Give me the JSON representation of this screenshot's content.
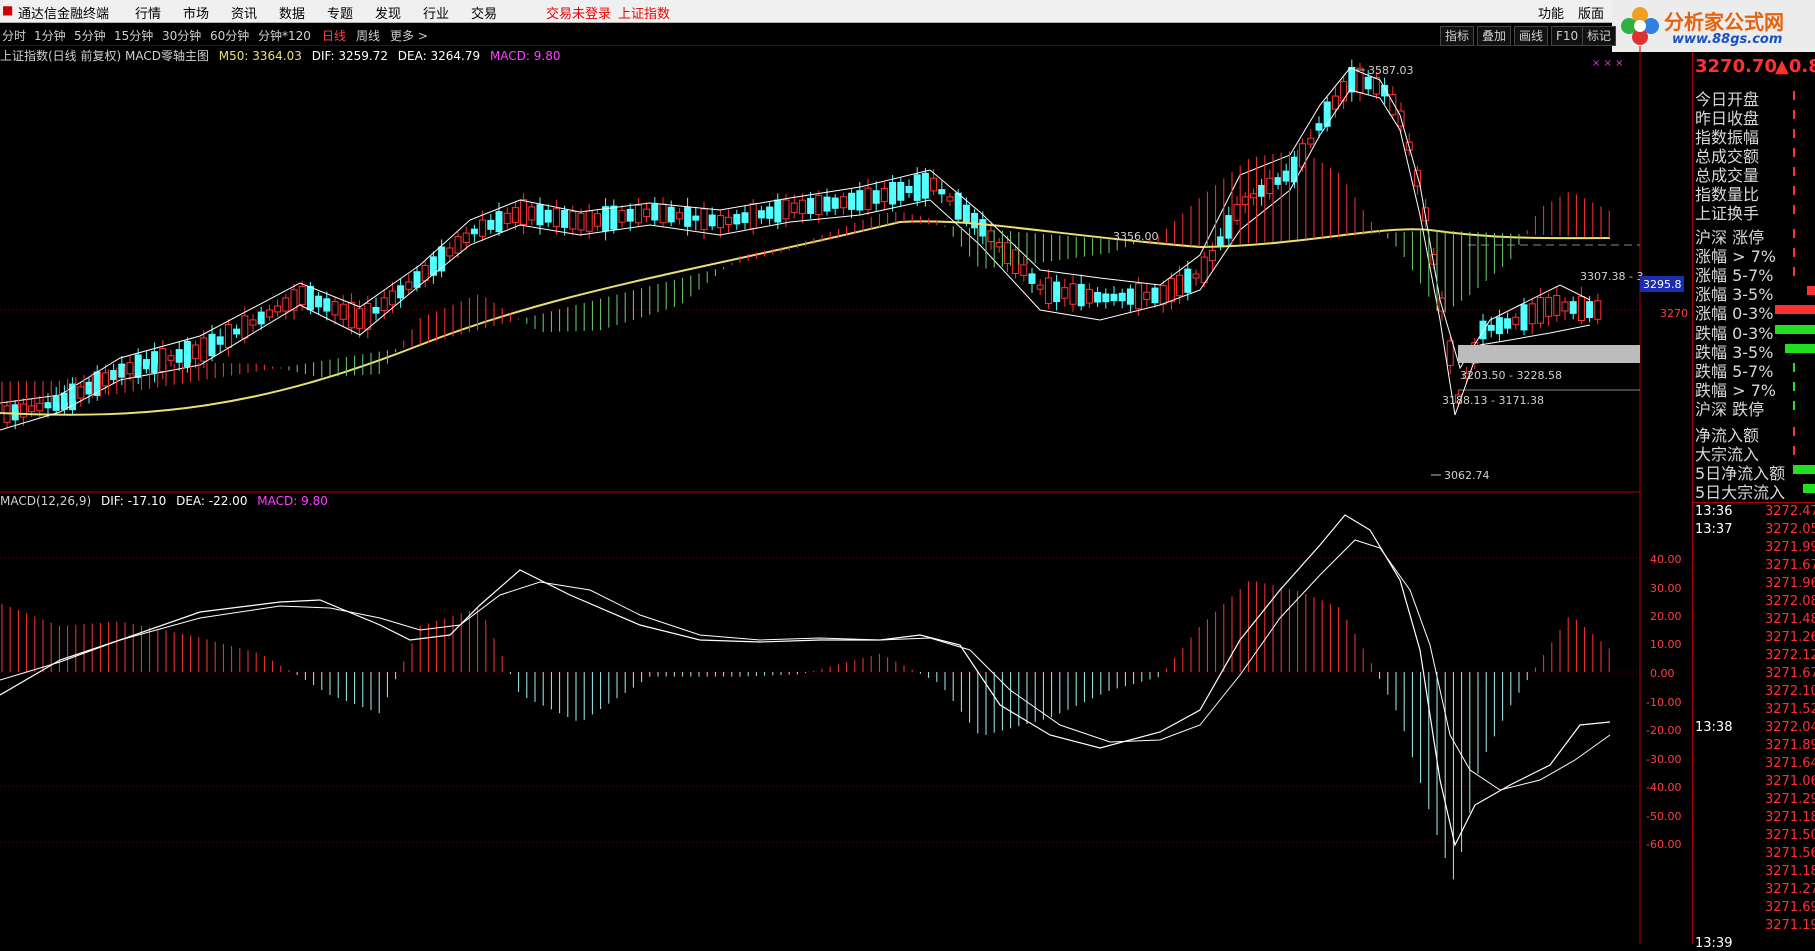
{
  "menubar": {
    "app_title": "通达信金融终端",
    "items": [
      "行情",
      "市场",
      "资讯",
      "数据",
      "专题",
      "发现",
      "行业",
      "交易"
    ],
    "login_status": "交易未登录",
    "index_name": "上证指数",
    "right_items": [
      "功能",
      "版面"
    ]
  },
  "watermark": {
    "title": "分析家公式网",
    "url": "www.88gs.com"
  },
  "period_tabs": [
    "分时",
    "1分钟",
    "5分钟",
    "15分钟",
    "30分钟",
    "60分钟",
    "分钟*120",
    "日线",
    "周线",
    "更多 >"
  ],
  "active_period": "日线",
  "toolbar_right": [
    "指标",
    "叠加",
    "画线",
    "F10",
    "标记"
  ],
  "main_info": {
    "title": "上证指数(日线 前复权) MACD零轴主图",
    "m50": "M50: 3364.03",
    "dif": "DIF: 3259.72",
    "dea": "DEA: 3264.79",
    "macd": "MACD: 9.80"
  },
  "macd_info": {
    "title": "MACD(12,26,9)",
    "dif": "DIF: -17.10",
    "dea": "DEA: -22.00",
    "macd": "MACD: 9.80"
  },
  "annotations": {
    "high": "3587.03",
    "low": "3062.74",
    "level1": "3356.00",
    "level2": "3307.38 - 3",
    "range1": "3203.50 - 3228.58",
    "range2": "3188.13 - 3171.38",
    "price_tag": "3295.8",
    "price_axis": "3270",
    "marks": "× × ×"
  },
  "macd_axis": [
    "40.00",
    "30.00",
    "20.00",
    "10.00",
    "0.00",
    "-10.00",
    "-20.00",
    "-30.00",
    "-40.00",
    "-50.00",
    "-60.00"
  ],
  "right_panel": {
    "price": "3270.70",
    "change": "▲0.8",
    "fields": [
      "今日开盘",
      "昨日收盘",
      "指数振幅",
      "总成交额",
      "总成交量",
      "指数量比",
      "上证换手",
      "沪深 涨停",
      "涨幅 > 7%",
      "涨幅 5-7%",
      "涨幅 3-5%",
      "涨幅 0-3%",
      "跌幅 0-3%",
      "跌幅 3-5%",
      "跌幅 5-7%",
      "跌幅 > 7%",
      "沪深 跌停",
      "净流入额",
      "大宗流入",
      "5日净流入额",
      "5日大宗流入"
    ],
    "ticks": [
      {
        "time": "13:36",
        "price": "3272.47"
      },
      {
        "time": "13:37",
        "price": "3272.05"
      },
      {
        "time": "",
        "price": "3271.99"
      },
      {
        "time": "",
        "price": "3271.67"
      },
      {
        "time": "",
        "price": "3271.96"
      },
      {
        "time": "",
        "price": "3272.08"
      },
      {
        "time": "",
        "price": "3271.48"
      },
      {
        "time": "",
        "price": "3271.26"
      },
      {
        "time": "",
        "price": "3272.12"
      },
      {
        "time": "",
        "price": "3271.67"
      },
      {
        "time": "",
        "price": "3272.10"
      },
      {
        "time": "",
        "price": "3271.52"
      },
      {
        "time": "13:38",
        "price": "3272.04"
      },
      {
        "time": "",
        "price": "3271.89"
      },
      {
        "time": "",
        "price": "3271.64"
      },
      {
        "time": "",
        "price": "3271.06"
      },
      {
        "time": "",
        "price": "3271.29"
      },
      {
        "time": "",
        "price": "3271.18"
      },
      {
        "time": "",
        "price": "3271.50"
      },
      {
        "time": "",
        "price": "3271.56"
      },
      {
        "time": "",
        "price": "3271.18"
      },
      {
        "time": "",
        "price": "3271.27"
      },
      {
        "time": "",
        "price": "3271.69"
      },
      {
        "time": "",
        "price": "3271.19"
      },
      {
        "time": "13:39",
        "price": ""
      }
    ]
  },
  "colors": {
    "up": "#ff3333",
    "down": "#54ffff",
    "ma50": "#e8e070",
    "line": "#ffffff",
    "grid": "#7a0000",
    "tag_bg": "#1c2cb0"
  }
}
